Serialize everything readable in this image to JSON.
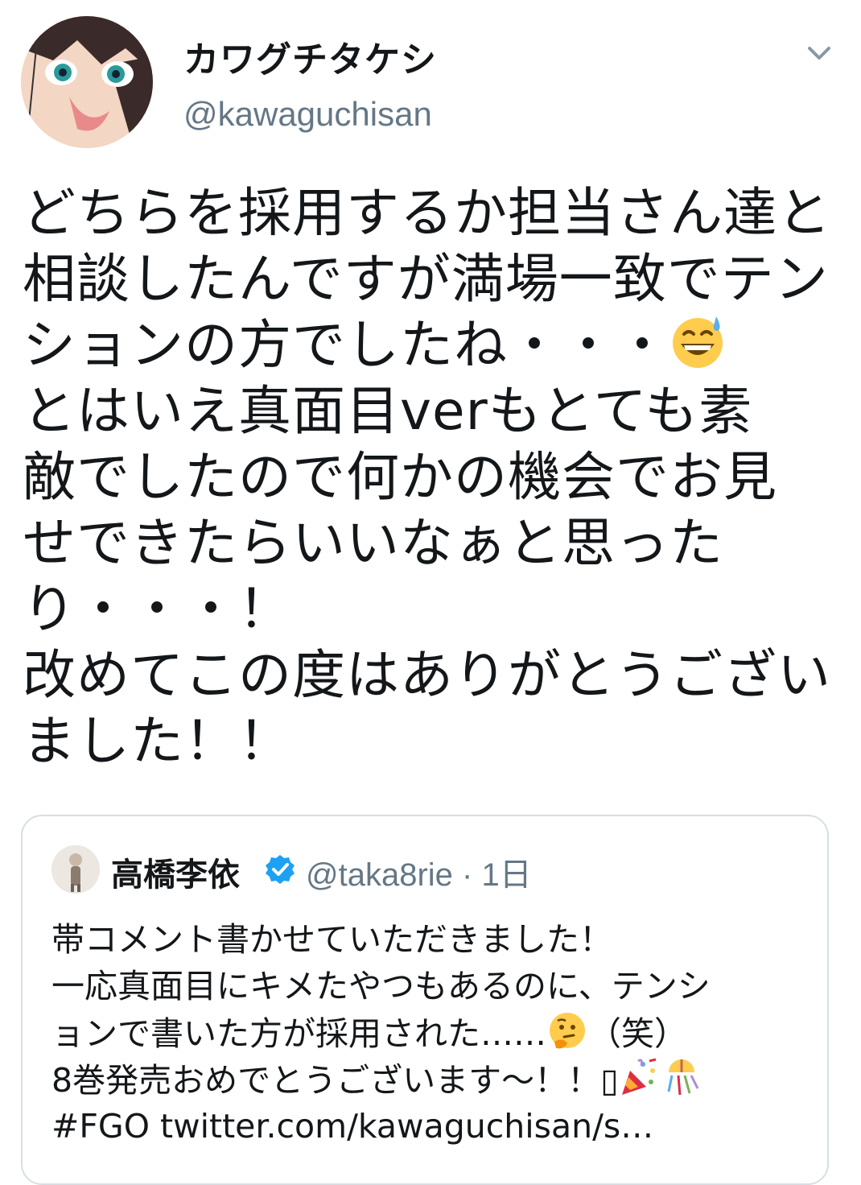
{
  "author": {
    "display_name": "カワグチタケシ",
    "handle": "@kawaguchisan"
  },
  "tweet": {
    "lines": [
      "どちらを採用するか担当さん達と",
      "相談したんですが満場一致でテン",
      "ションの方でしたね・・・",
      "とはいえ真面目verもとても素",
      "敵でしたので何かの機会でお見",
      "せできたらいいなぁと思った",
      "り・・・！",
      "改めてこの度はありがとうござい",
      "ました！！"
    ],
    "emoji_line3": "grinning-face-with-sweat-icon"
  },
  "quoted_tweet": {
    "display_name": "高橋李依",
    "handle": "@taka8rie",
    "time": " · 1日",
    "lines": [
      "帯コメント書かせていただきました！",
      "一応真面目にキメたやつもあるのに、テンシ",
      "ョンで書いた方が採用された……",
      "8巻発売おめでとうございます〜！！",
      "#FGO twitter.com/kawaguchisan/s…"
    ],
    "line3_suffix": "（笑）",
    "line4_glyph": "▯"
  },
  "colors": {
    "text": "#14171a",
    "secondary": "#657786",
    "verified": "#1da1f2",
    "border": "#d8dee3"
  }
}
